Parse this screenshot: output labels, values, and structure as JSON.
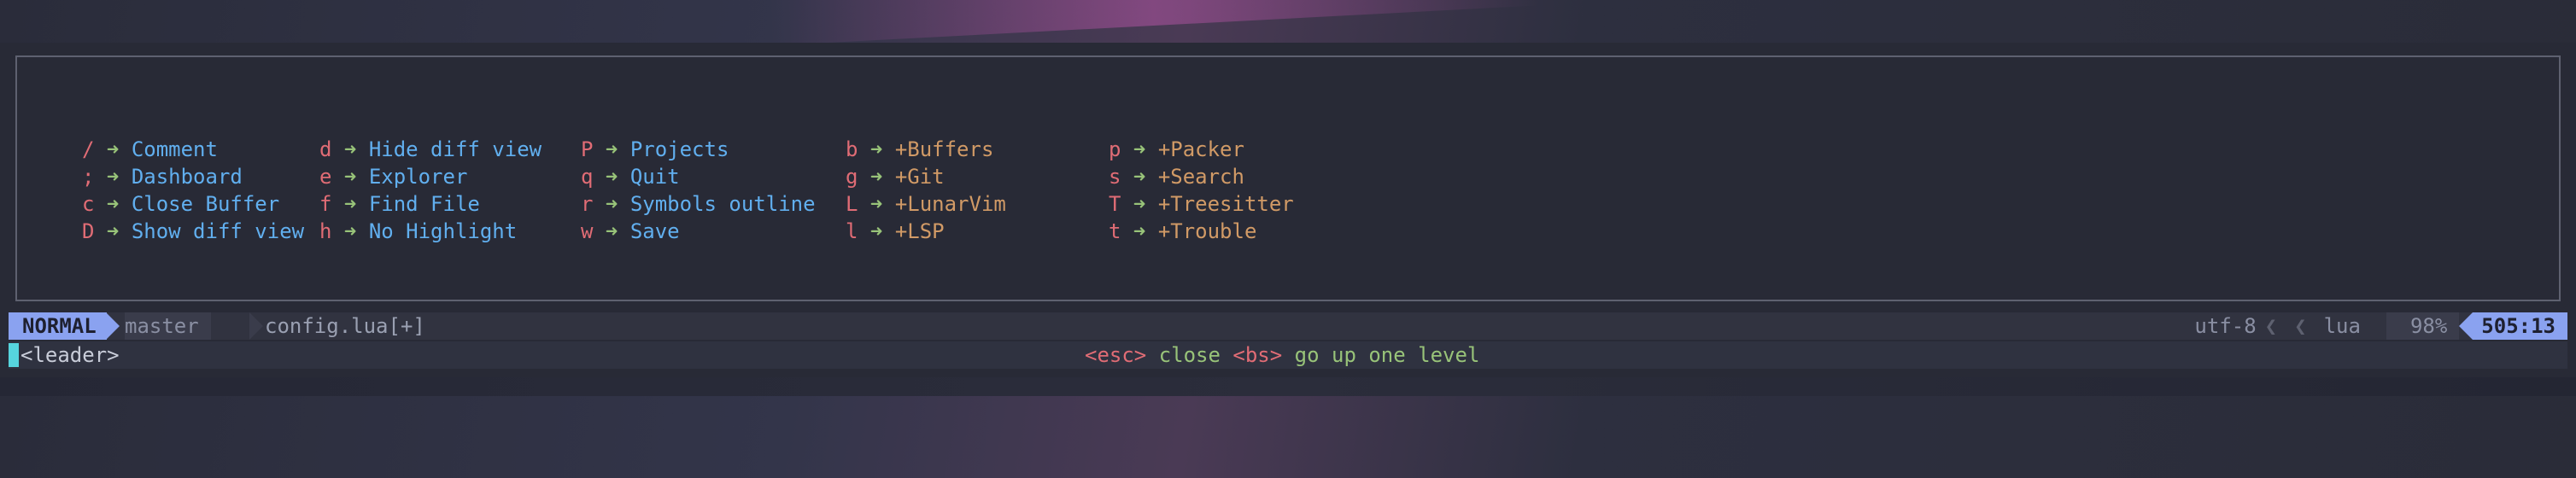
{
  "whichkey": {
    "columns": [
      {
        "left": "x",
        "items": [
          {
            "key": "/",
            "label": "Comment",
            "type": "cmd"
          },
          {
            "key": ";",
            "label": "Dashboard",
            "type": "cmd"
          },
          {
            "key": "c",
            "label": "Close Buffer",
            "type": "cmd"
          },
          {
            "key": "D",
            "label": "Show diff view",
            "type": "cmd"
          }
        ]
      },
      {
        "items": [
          {
            "key": "d",
            "label": "Hide diff view",
            "type": "cmd"
          },
          {
            "key": "e",
            "label": "Explorer",
            "type": "cmd"
          },
          {
            "key": "f",
            "label": "Find File",
            "type": "cmd"
          },
          {
            "key": "h",
            "label": "No Highlight",
            "type": "cmd"
          }
        ]
      },
      {
        "items": [
          {
            "key": "P",
            "label": "Projects",
            "type": "cmd"
          },
          {
            "key": "q",
            "label": "Quit",
            "type": "cmd"
          },
          {
            "key": "r",
            "label": "Symbols outline",
            "type": "cmd"
          },
          {
            "key": "w",
            "label": "Save",
            "type": "cmd"
          }
        ]
      },
      {
        "items": [
          {
            "key": "b",
            "label": "+Buffers",
            "type": "group"
          },
          {
            "key": "g",
            "label": "+Git",
            "type": "group"
          },
          {
            "key": "L",
            "label": "+LunarVim",
            "type": "group"
          },
          {
            "key": "l",
            "label": "+LSP",
            "type": "group"
          }
        ]
      },
      {
        "items": [
          {
            "key": "p",
            "label": "+Packer",
            "type": "group"
          },
          {
            "key": "s",
            "label": "+Search",
            "type": "group"
          },
          {
            "key": "T",
            "label": "+Treesitter",
            "type": "group"
          },
          {
            "key": "t",
            "label": "+Trouble",
            "type": "group"
          }
        ]
      }
    ],
    "arrow": "➜"
  },
  "statusline": {
    "mode": "NORMAL",
    "branch_icon": "",
    "branch": "master",
    "filename": "config.lua[+]",
    "encoding": "utf-8",
    "separator": "❮",
    "drop_icon": "",
    "lua_icon": "",
    "filetype": "lua",
    "percent": "98%",
    "position": "505:13"
  },
  "cmdline": {
    "leader": "<leader>",
    "esc_key": "<esc>",
    "esc_text": " close ",
    "bs_key": "<bs>",
    "bs_text": " go up one level"
  },
  "colors": {
    "key": "#e06c75",
    "arrow": "#98c379",
    "cmd": "#61afef",
    "group": "#d19a66",
    "mode_bg": "#8aa2f0"
  }
}
